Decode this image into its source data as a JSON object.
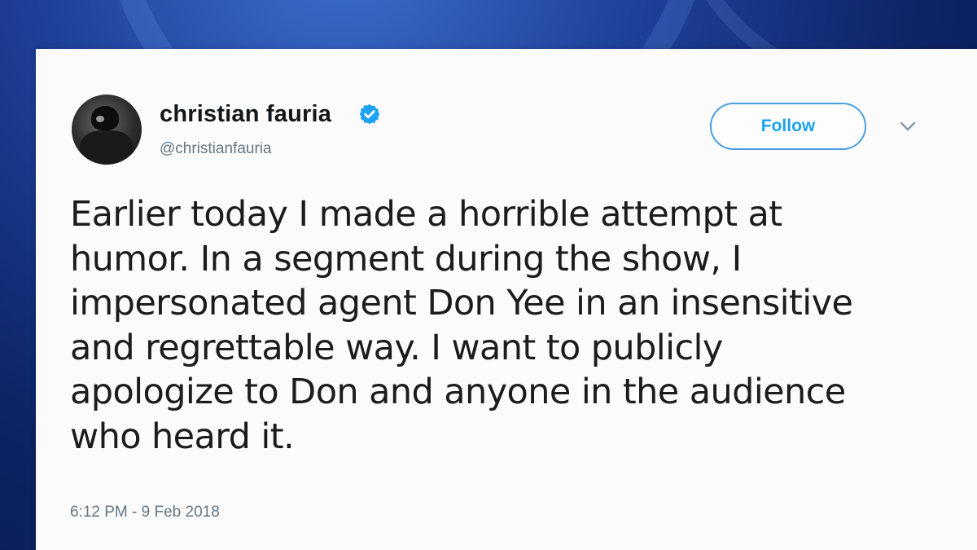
{
  "tweet": {
    "author": {
      "display_name": "christian fauria",
      "handle": "@christianfauria",
      "verified": true,
      "avatar_icon": "avatar"
    },
    "follow_label": "Follow",
    "menu_icon": "chevron-down-icon",
    "text_lines": [
      "Earlier today I made a horrible attempt at",
      "humor. In a segment during the show, I",
      "impersonated agent Don Yee in an insensitive",
      "and regrettable way. I want to publicly",
      "apologize to Don and anyone in the audience",
      "who heard it."
    ],
    "timestamp": "6:12 PM - 9 Feb 2018"
  },
  "colors": {
    "accent": "#1da1f2",
    "background_blue": "#1d3f96",
    "card": "#fbfbfb",
    "secondary_text": "#657786"
  }
}
